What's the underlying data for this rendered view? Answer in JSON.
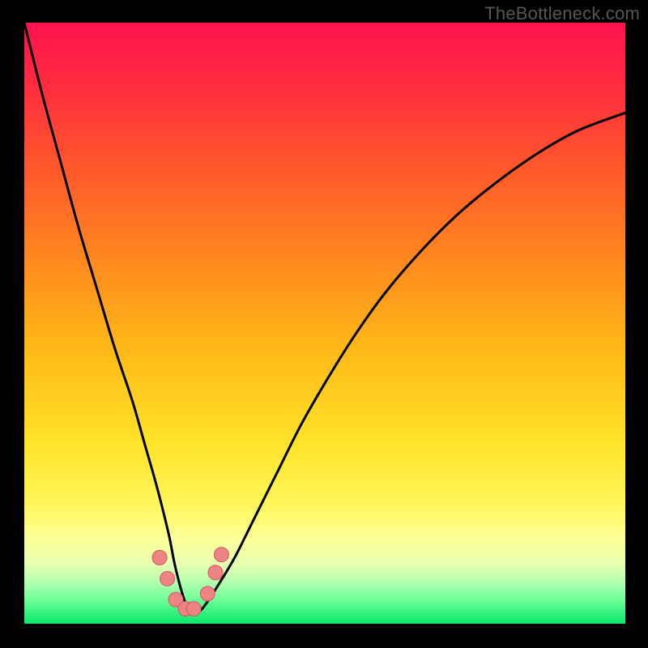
{
  "watermark": "TheBottleneck.com",
  "colors": {
    "frame": "#000000",
    "gradient_stops": [
      {
        "offset": 0.0,
        "color": "#ff1250"
      },
      {
        "offset": 0.1,
        "color": "#ff2b3f"
      },
      {
        "offset": 0.25,
        "color": "#ff5a2a"
      },
      {
        "offset": 0.4,
        "color": "#ff8a1e"
      },
      {
        "offset": 0.55,
        "color": "#ffbb17"
      },
      {
        "offset": 0.7,
        "color": "#ffe329"
      },
      {
        "offset": 0.8,
        "color": "#fff65a"
      },
      {
        "offset": 0.86,
        "color": "#fdff9a"
      },
      {
        "offset": 0.9,
        "color": "#e6ffb0"
      },
      {
        "offset": 0.93,
        "color": "#b6ffb0"
      },
      {
        "offset": 0.96,
        "color": "#6eff97"
      },
      {
        "offset": 1.0,
        "color": "#08e66a"
      }
    ],
    "curve": "#000000",
    "marker_fill": "#ed8383",
    "marker_stroke": "#cf5a62"
  },
  "chart_data": {
    "type": "line",
    "title": "",
    "xlabel": "",
    "ylabel": "",
    "xlim": [
      0,
      100
    ],
    "ylim": [
      0,
      100
    ],
    "series": [
      {
        "name": "bottleneck-curve",
        "x": [
          0,
          3,
          6,
          9,
          12,
          15,
          18,
          20,
          22,
          24,
          25,
          26,
          27,
          28,
          29,
          30,
          32,
          35,
          38,
          42,
          46,
          50,
          55,
          60,
          66,
          72,
          78,
          85,
          92,
          100
        ],
        "y": [
          100,
          88,
          77,
          66,
          56,
          46,
          37,
          30,
          23,
          15,
          10,
          6,
          3,
          2,
          2,
          3,
          6,
          11,
          17,
          25,
          33,
          40,
          48,
          55,
          62,
          68,
          73,
          78,
          82,
          85
        ]
      }
    ],
    "markers": {
      "name": "highlight-cluster",
      "points": [
        {
          "x": 22.5,
          "y": 11.0
        },
        {
          "x": 23.8,
          "y": 7.5
        },
        {
          "x": 25.2,
          "y": 4.0
        },
        {
          "x": 26.8,
          "y": 2.5
        },
        {
          "x": 28.2,
          "y": 2.5
        },
        {
          "x": 30.5,
          "y": 5.0
        },
        {
          "x": 31.8,
          "y": 8.5
        },
        {
          "x": 32.8,
          "y": 11.5
        }
      ],
      "radius_px": 9
    }
  }
}
